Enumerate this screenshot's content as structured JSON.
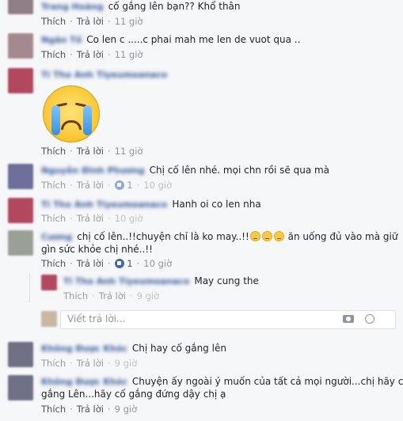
{
  "comments": [
    {
      "name": "Trang Hoàng",
      "text": "cố gắng lên bạn?? Khổ thân",
      "like": "Thích",
      "reply": "Trả lời",
      "time": "11 giờ",
      "avatar_color": "#8f7e86"
    },
    {
      "name": "Ngân Tố",
      "text": "Co len c .....c phai mah me len de vuot qua ..",
      "like": "Thích",
      "reply": "Trả lời",
      "time": "11 giờ",
      "avatar_color": "#a48a8e"
    },
    {
      "name": "Ti Tho Anh Tiyeumoanaco",
      "text": "",
      "like": "Thích",
      "reply": "Trả lời",
      "time": "11 giờ",
      "avatar_color": "#b2485e",
      "sticker": "crying-face"
    },
    {
      "name": "Nguyễn Đinh Phương",
      "text": "Chị cố lên nhé. mọi chn rồi sẽ qua mà",
      "like": "Thích",
      "reply": "Trả lời",
      "likes": "1",
      "time": "10 giờ",
      "avatar_color": "#6e6f9a"
    },
    {
      "name": "Ti Tho Anh Tiyeumoanaco",
      "text": "Hanh oi co len nha",
      "like": "Thích",
      "reply": "Trả lời",
      "time": "10 giờ",
      "avatar_color": "#b2485e"
    },
    {
      "name": "Cương",
      "text": "chị cố lên..!!chuyện chỉ là ko may..!!",
      "text2": "ăn uống đủ vào mà giữ",
      "text3": "gìn sức khỏe chị nhé..!!",
      "like": "Thích",
      "reply": "Trả lời",
      "likes": "1",
      "time": "10 giờ",
      "avatar_color": "#9aa097"
    }
  ],
  "nested_reply": {
    "name": "Ti Tho Anh Tiyeumoanaco",
    "text": "May cung the",
    "like": "Thích",
    "reply": "Trả lời",
    "time": "9 giờ",
    "avatar_color": "#b2485e"
  },
  "reply_input": {
    "placeholder": "Viết trả lời..."
  },
  "comments_after": [
    {
      "name": "Không Được Khóc",
      "text": "Chị hay cố gắng lên",
      "like": "Thích",
      "reply": "Trả lời",
      "time": "9 giờ",
      "avatar_color": "#6f6f86"
    },
    {
      "name": "Không Được Khóc",
      "text": "Chuyện ấy ngoài ý muốn của tất cả mọi người...chị hãy cố",
      "text2": "gắng Lên...hãy cố gắng đứng dậy chị ạ",
      "like": "Thích",
      "reply": "Trả lời",
      "time": "9 giờ",
      "avatar_color": "#6f6f86"
    }
  ]
}
